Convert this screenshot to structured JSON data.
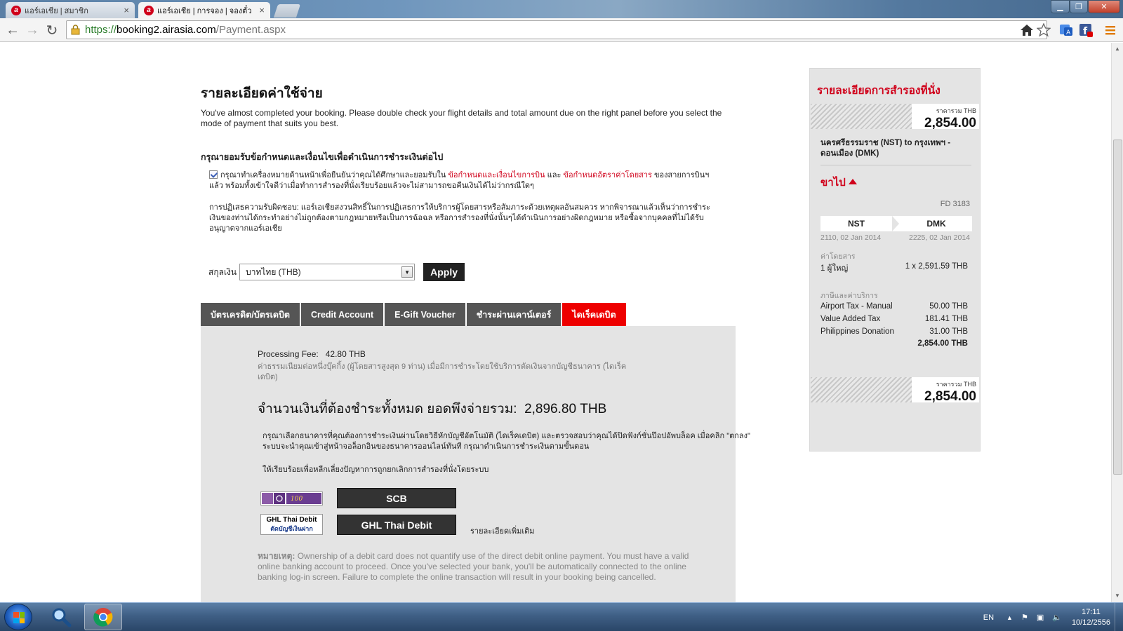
{
  "browser": {
    "tabs": [
      {
        "title": "แอร์เอเชีย | สมาชิก",
        "active": false
      },
      {
        "title": "แอร์เอเชีย | การจอง | จองตั๋ว",
        "active": true
      }
    ],
    "url": {
      "scheme": "https://",
      "host": "booking2.airasia.com",
      "path": "/Payment.aspx"
    },
    "fav_letter": "a"
  },
  "page": {
    "title": "รายละเอียดค่าใช้จ่าย",
    "intro": "You've almost completed your booking. Please double check your flight details and total amount due on the right panel before you select the mode of payment that suits you best.",
    "terms_heading": "กรุณายอมรับข้อกำหนดและเงื่อนไขเพื่อดำเนินการชำระเงินต่อไป",
    "terms": {
      "checked": true,
      "text_before": "กรุณาทำเครื่องหมายด้านหน้าเพื่อยืนยันว่าคุณได้ศึกษาและยอมรับใน ",
      "link1": "ข้อกำหนดและเงื่อนไขการบิน",
      "text_and": " และ ",
      "link2": "ข้อกำหนดอัตราค่าโดยสาร",
      "text_after": " ของสายการบินฯ แล้ว พร้อมทั้งเข้าใจดีว่าเมื่อทำการสำรองที่นั่งเรียบร้อยแล้วจะไม่สามารถขอคืนเงินได้ไม่ว่ากรณีใดๆ"
    },
    "disclaimer": "การปฏิเสธความรับผิดชอบ: แอร์เอเชียสงวนสิทธิ์ในการปฏิเสธการให้บริการผู้โดยสารหรือสัมภาระด้วยเหตุผลอันสมควร หากพิจารณาแล้วเห็นว่าการชำระเงินของท่านได้กระทำอย่างไม่ถูกต้องตามกฎหมายหรือเป็นการฉ้อฉล หรือการสำรองที่นั่งนั้นๆได้ดำเนินการอย่างผิดกฎหมาย หรือซื้อจากบุคคลที่ไม่ได้รับอนุญาตจากแอร์เอเชีย",
    "currency": {
      "label": "สกุลเงิน",
      "selected": "บาทไทย (THB)",
      "apply": "Apply"
    },
    "payment_tabs": [
      {
        "label": "บัตรเครดิต/บัตรเดบิต",
        "active": false
      },
      {
        "label": "Credit Account",
        "active": false
      },
      {
        "label": "E-Gift Voucher",
        "active": false
      },
      {
        "label": "ชำระผ่านเคาน์เตอร์",
        "active": false
      },
      {
        "label": "ไดเร็คเดบิต",
        "active": true
      }
    ],
    "panel": {
      "fee_label": "Processing Fee:",
      "fee_value": "42.80 THB",
      "fee_note": "ค่าธรรมเนียมต่อหนึ่งบุ๊คกิ้ง (ผู้โดยสารสูงสุด 9 ท่าน) เมื่อมีการชำระโดยใช้บริการตัดเงินจากบัญชีธนาคาร (ไดเร็คเดบิต)",
      "total_label": "จำนวนเงินที่ต้องชำระทั้งหมด ยอดพึงจ่ายรวม:",
      "total_value": "2,896.80 THB",
      "bank_instruction": "กรุณาเลือกธนาคารที่คุณต้องการชำระเงินผ่านโดยวิธีหักบัญชีอัตโนมัติ (ไดเร็คเดบิต) และตรวจสอบว่าคุณได้ปิดฟังก์ชั่นป๊อปอัพบล็อค เมื่อคลิก \"ตกลง\" ระบบจะนำคุณเข้าสู่หน้าจอล็อกอินของธนาคารออนไลน์ทันที กรุณาดำเนินการชำระเงินตามขั้นตอน",
      "bank_note2": "ให้เรียบร้อยเพื่อหลีกเลี่ยงปัญหาการถูกยกเลิกการสำรองที่นั่งโดยระบบ",
      "banks": [
        {
          "name": "SCB"
        },
        {
          "name": "GHL Thai Debit",
          "logo_line1": "GHL Thai Debit",
          "logo_line2": "ตัดบัญชีเงินฝาก"
        }
      ],
      "more_details": "รายละเอียดเพิ่มเติม",
      "remark_label": "หมายเหตุ:",
      "remark_text": " Ownership of a debit card does not quantify use of the direct debit online payment. You must have a valid online banking account to proceed. Once you've selected your bank, you'll be automatically connected to the online banking log-in screen. Failure to complete the online transaction will result in your booking being cancelled."
    }
  },
  "summary": {
    "title": "รายละเอียดการสำรองที่นั่ง",
    "total_label": "ราคารวม  THB",
    "total_value": "2,854.00",
    "route_name": "นครศรีธรรมราช (NST) to กรุงเทพฯ - ดอนเมือง (DMK)",
    "outbound_label": "ขาไป",
    "flight_no": "FD 3183",
    "from_code": "NST",
    "to_code": "DMK",
    "depart": "2110, 02 Jan 2014",
    "arrive": "2225, 02 Jan 2014",
    "fare_heading": "ค่าโดยสาร",
    "fare_pax": "1 ผู้ใหญ่",
    "fare_value": "1 x 2,591.59 THB",
    "tax_heading": "ภาษีและค่าบริการ",
    "taxes": [
      {
        "name": "Airport Tax - Manual",
        "value": "50.00 THB"
      },
      {
        "name": "Value Added Tax",
        "value": "181.41 THB"
      },
      {
        "name": "Philippines Donation",
        "value": "31.00 THB"
      }
    ],
    "subtotal": "2,854.00 THB"
  },
  "taskbar": {
    "lang": "EN",
    "time": "17:11",
    "date": "10/12/2556"
  },
  "colors": {
    "brand_red": "#d0021b",
    "active_tab": "#ee0000",
    "tab_grey": "#555555",
    "panel_grey": "#e4e4e4"
  }
}
